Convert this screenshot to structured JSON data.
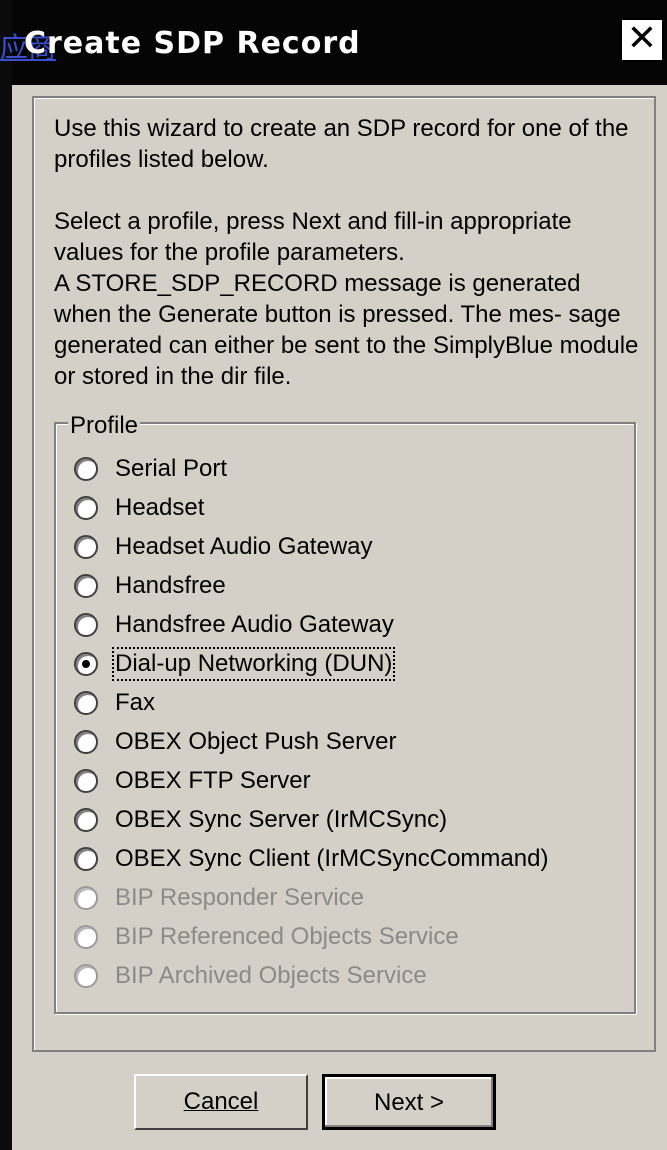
{
  "window": {
    "title": "Create SDP Record",
    "corner_link": "应商",
    "close_glyph": "✕"
  },
  "intro": {
    "paragraph1": "Use this wizard to create an SDP record for one of the profiles listed below.",
    "paragraph2_line1": "Select a profile, press Next and fill-in appropriate values for the profile parameters.",
    "paragraph2_line2": "A STORE_SDP_RECORD message is generated when the Generate button is pressed. The mes- sage generated can either be sent to the SimplyBlue module or stored in the dir file."
  },
  "profile_group": {
    "label": "Profile",
    "selected": "Dial-up Networking (DUN)",
    "options": [
      {
        "label": "Serial Port",
        "enabled": true
      },
      {
        "label": "Headset",
        "enabled": true
      },
      {
        "label": "Headset Audio Gateway",
        "enabled": true
      },
      {
        "label": "Handsfree",
        "enabled": true
      },
      {
        "label": "Handsfree Audio Gateway",
        "enabled": true
      },
      {
        "label": "Dial-up Networking (DUN)",
        "enabled": true
      },
      {
        "label": "Fax",
        "enabled": true
      },
      {
        "label": "OBEX Object Push Server",
        "enabled": true
      },
      {
        "label": "OBEX FTP Server",
        "enabled": true
      },
      {
        "label": "OBEX Sync Server (IrMCSync)",
        "enabled": true
      },
      {
        "label": "OBEX Sync Client (IrMCSyncCommand)",
        "enabled": true
      },
      {
        "label": "BIP Responder Service",
        "enabled": false
      },
      {
        "label": "BIP Referenced Objects Service",
        "enabled": false
      },
      {
        "label": "BIP Archived Objects Service",
        "enabled": false
      }
    ]
  },
  "buttons": {
    "cancel": "Cancel",
    "next": "Next >"
  }
}
